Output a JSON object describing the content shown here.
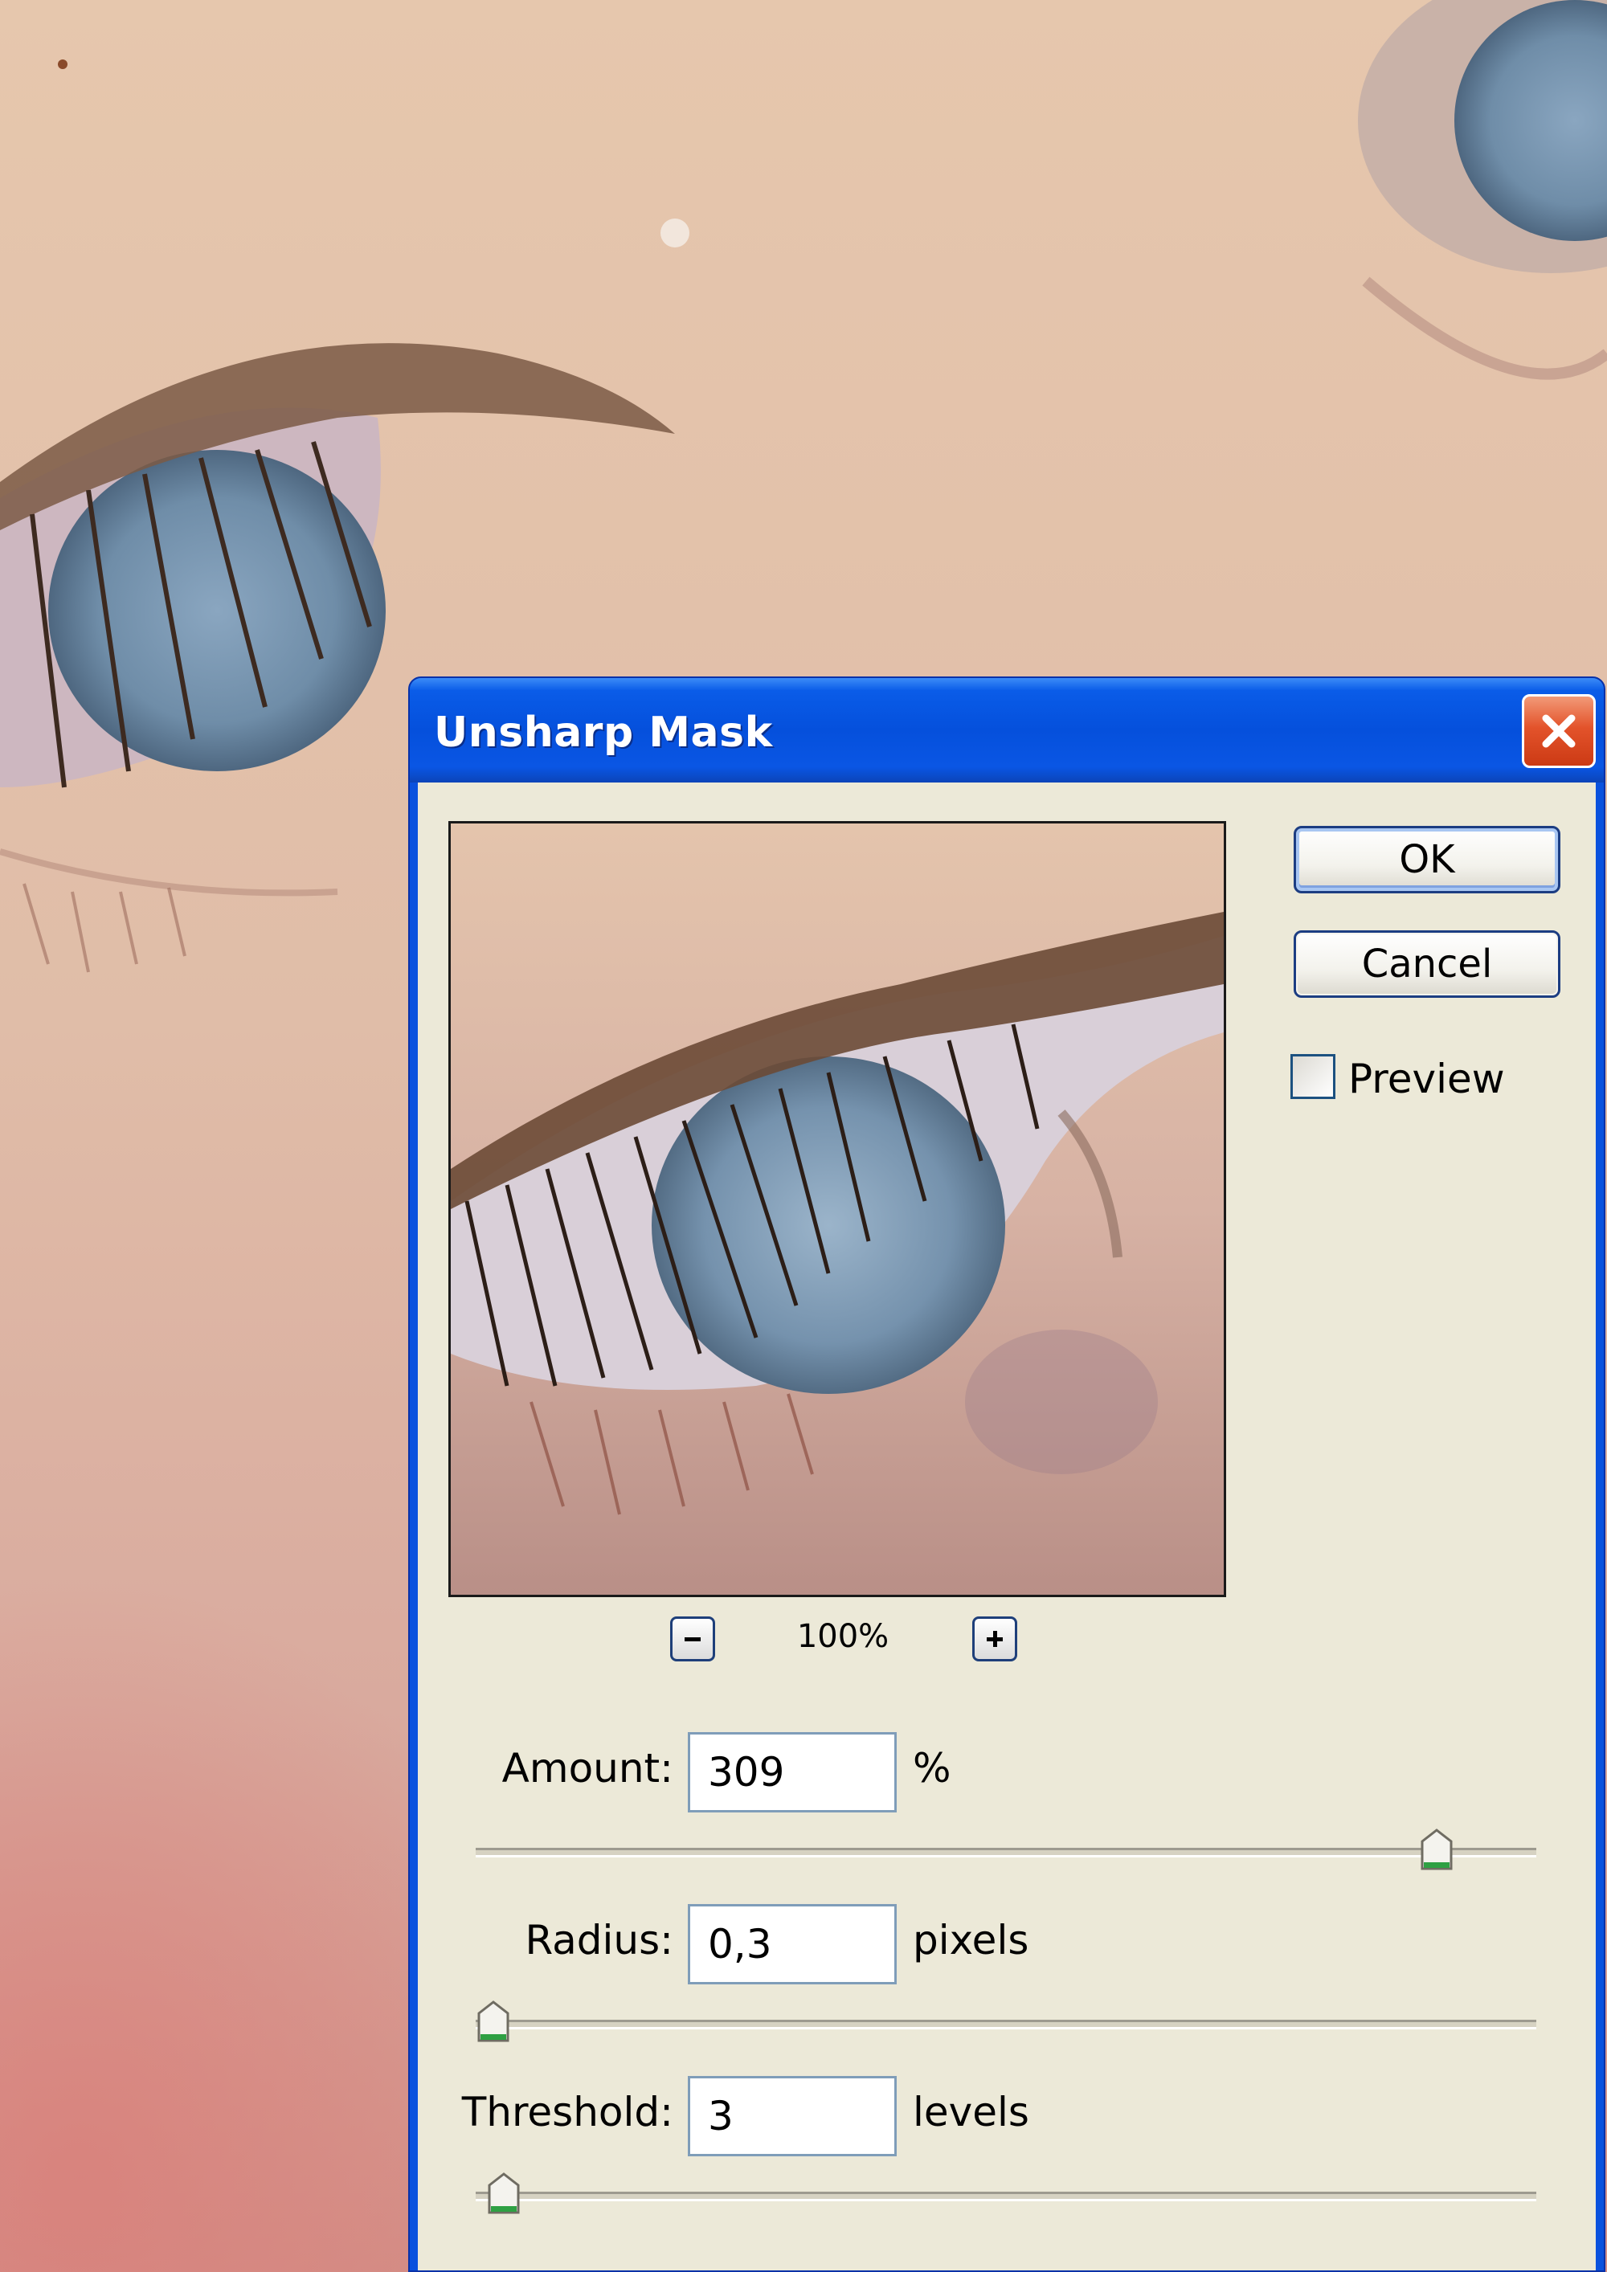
{
  "dialog": {
    "title": "Unsharp Mask",
    "ok_label": "OK",
    "cancel_label": "Cancel",
    "preview_label": "Preview",
    "preview_checked": false,
    "zoom_level": "100%",
    "fields": {
      "amount": {
        "label": "Amount:",
        "value": "309",
        "unit": "%"
      },
      "radius": {
        "label": "Radius:",
        "value": "0,3",
        "unit": "pixels"
      },
      "threshold": {
        "label": "Threshold:",
        "value": "3",
        "unit": "levels"
      }
    },
    "sliders": {
      "amount_position": 0.92,
      "radius_position": 0.0,
      "threshold_position": 0.01
    }
  },
  "icons": {
    "close": "close-icon",
    "zoom_out": "minus-icon",
    "zoom_in": "plus-icon",
    "slider_thumb": "slider-thumb-icon"
  },
  "colors": {
    "titlebar": "#0a52de",
    "client": "#ece9d8",
    "close_button": "#e3532b",
    "slider_thumb_accent": "#2ea043"
  }
}
